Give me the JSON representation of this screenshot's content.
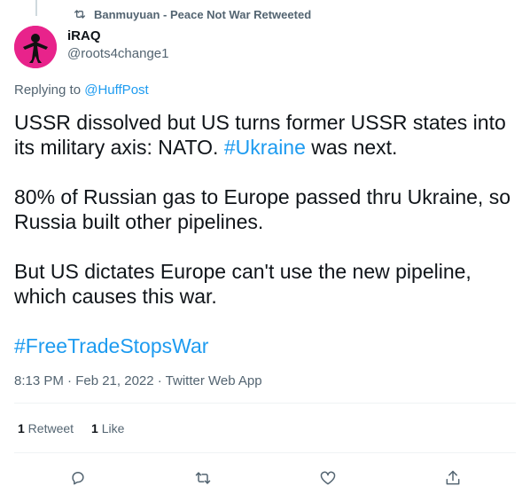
{
  "retweet_context": "Banmuyuan - Peace Not War Retweeted",
  "author": {
    "display_name": "iRAQ",
    "handle": "@roots4change1"
  },
  "replying": {
    "prefix": "Replying to ",
    "mention": "@HuffPost"
  },
  "tweet": {
    "p1_a": "USSR dissolved but US turns former USSR states into its military axis: NATO. ",
    "p1_hashtag": "#Ukraine",
    "p1_b": " was next.",
    "p2": "80% of Russian gas to Europe passed thru Ukraine, so Russia built other pipelines.",
    "p3": "But US dictates Europe can't use the new pipeline, which causes this war.",
    "p4_hashtag": "#FreeTradeStopsWar"
  },
  "meta": "8:13 PM · Feb 21, 2022 · Twitter Web App",
  "stats": {
    "retweets_count": "1",
    "retweets_label": " Retweet",
    "likes_count": "1",
    "likes_label": " Like"
  },
  "colors": {
    "link": "#1d9bf0",
    "text": "#0f1419",
    "secondary": "#536471",
    "avatar_bg": "#e8238b"
  }
}
